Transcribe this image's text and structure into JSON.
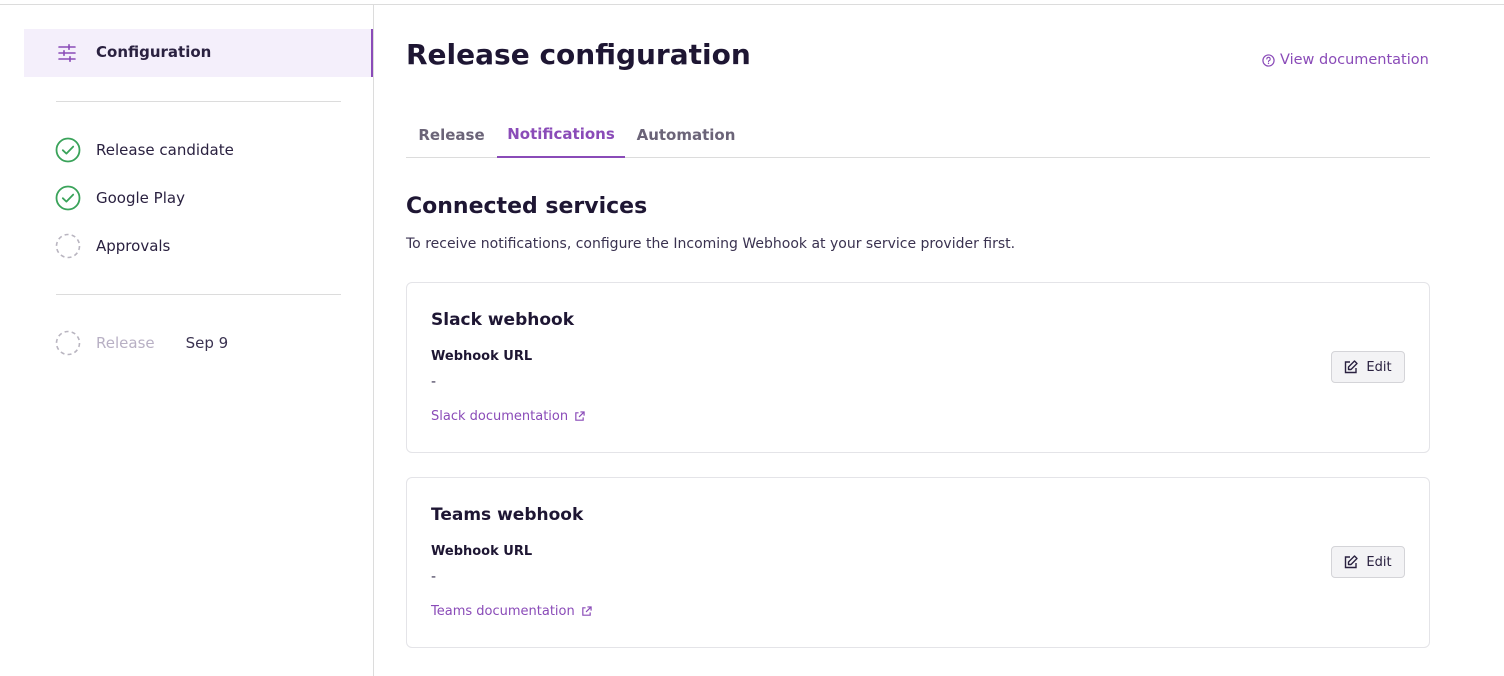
{
  "sidebar": {
    "active_item": {
      "label": "Configuration",
      "icon": "sliders-icon"
    },
    "steps": [
      {
        "label": "Release candidate",
        "status": "complete",
        "icon": "check-circle-icon"
      },
      {
        "label": "Google Play",
        "status": "complete",
        "icon": "check-circle-icon"
      },
      {
        "label": "Approvals",
        "status": "pending",
        "icon": "dashed-circle-icon"
      }
    ],
    "release_step": {
      "label": "Release",
      "date": "Sep 9",
      "status": "pending",
      "icon": "dashed-circle-icon"
    }
  },
  "header": {
    "title": "Release configuration",
    "doc_link": {
      "label": "View documentation",
      "icon": "help-circle-icon"
    }
  },
  "tabs": [
    {
      "label": "Release",
      "active": false
    },
    {
      "label": "Notifications",
      "active": true
    },
    {
      "label": "Automation",
      "active": false
    }
  ],
  "section": {
    "title": "Connected services",
    "description": "To receive notifications, configure the Incoming Webhook at your service provider first."
  },
  "cards": [
    {
      "title": "Slack webhook",
      "field_label": "Webhook URL",
      "field_value": "-",
      "doc_link": "Slack documentation",
      "edit_label": "Edit"
    },
    {
      "title": "Teams webhook",
      "field_label": "Webhook URL",
      "field_value": "-",
      "doc_link": "Teams documentation",
      "edit_label": "Edit"
    }
  ],
  "colors": {
    "accent": "#8a4bb8",
    "success": "#3aa35a",
    "pending": "#b9b5c0",
    "text": "#1e1633"
  }
}
